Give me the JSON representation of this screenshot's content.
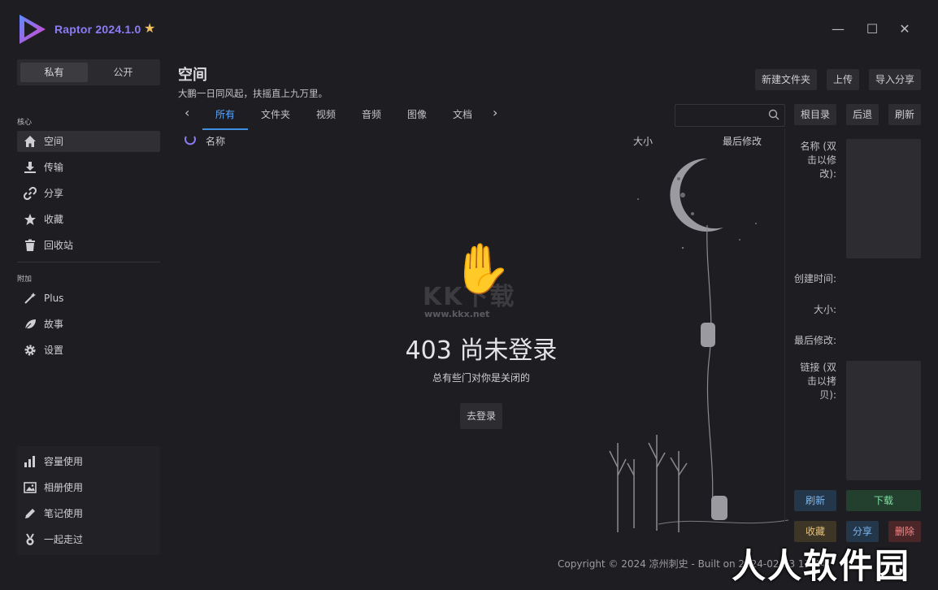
{
  "app": {
    "title": "Raptor 2024.1.0"
  },
  "window": {
    "minimize": "—",
    "maximize": "☐",
    "close": "✕"
  },
  "sidebar": {
    "segments": [
      "私有",
      "公开"
    ],
    "core_label": "核心",
    "core_items": [
      {
        "label": "空间",
        "icon": "home-icon"
      },
      {
        "label": "传输",
        "icon": "download-icon"
      },
      {
        "label": "分享",
        "icon": "link-icon"
      },
      {
        "label": "收藏",
        "icon": "star-icon"
      },
      {
        "label": "回收站",
        "icon": "trash-icon"
      }
    ],
    "extra_label": "附加",
    "extra_items": [
      {
        "label": "Plus",
        "icon": "magic-wand-icon"
      },
      {
        "label": "故事",
        "icon": "leaf-icon"
      },
      {
        "label": "设置",
        "icon": "gear-icon"
      }
    ],
    "usage_items": [
      {
        "label": "容量使用",
        "icon": "bar-chart-icon"
      },
      {
        "label": "相册使用",
        "icon": "image-icon"
      },
      {
        "label": "笔记使用",
        "icon": "pencil-icon"
      },
      {
        "label": "一起走过",
        "icon": "medal-icon"
      }
    ]
  },
  "header": {
    "title": "空间",
    "subtitle": "大鹏一日同风起，扶摇直上九万里。",
    "actions": [
      "新建文件夹",
      "上传",
      "导入分享"
    ]
  },
  "tabs": [
    "所有",
    "文件夹",
    "视频",
    "音频",
    "图像",
    "文档"
  ],
  "toolbar": {
    "search_placeholder": "",
    "buttons": [
      "根目录",
      "后退",
      "刷新"
    ]
  },
  "columns": {
    "name": "名称",
    "size": "大小",
    "modified": "最后修改"
  },
  "empty_state": {
    "watermark": "KK下载",
    "watermark_url": "www.kkx.net",
    "title": "403 尚未登录",
    "subtitle": "总有些门对你是关闭的",
    "button": "去登录"
  },
  "details": {
    "name_label": "名称 (双击以修改):",
    "created_label": "创建时间:",
    "size_label": "大小:",
    "modified_label": "最后修改:",
    "link_label": "链接 (双击以拷贝):",
    "buttons": {
      "refresh": "刷新",
      "download": "下载",
      "favorite": "收藏",
      "share": "分享",
      "delete": "删除"
    }
  },
  "footer": {
    "copyright": "Copyright © 2024 凉州刺史 - Built on 2024-02-13 13:44"
  },
  "overlay_watermark": "人人软件园",
  "colors": {
    "accent": "#3f8ee0",
    "bg": "#1e1e22",
    "panel": "#2c2c31"
  }
}
